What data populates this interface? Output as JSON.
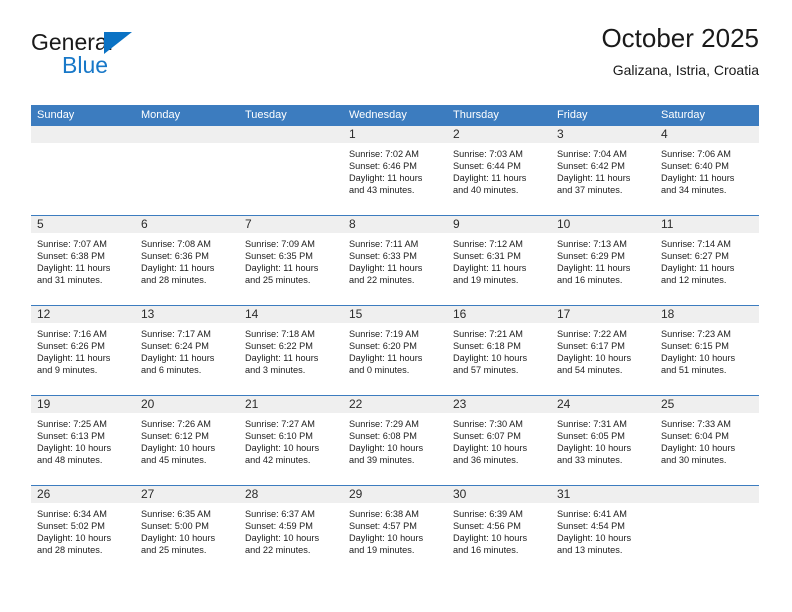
{
  "brand": {
    "name_top": "General",
    "name_bottom": "Blue",
    "triangle_icon": "triangle-icon",
    "accent_color": "#1878c8"
  },
  "header": {
    "title": "October 2025",
    "subtitle": "Galizana, Istria, Croatia"
  },
  "theme": {
    "header_blue": "#3c7cbf",
    "day_band_gray": "#efefef",
    "text_color": "#1d1d1d"
  },
  "calendar": {
    "weekdays": [
      "Sunday",
      "Monday",
      "Tuesday",
      "Wednesday",
      "Thursday",
      "Friday",
      "Saturday"
    ],
    "weeks": [
      [
        {
          "day": "",
          "empty": true,
          "lines": []
        },
        {
          "day": "",
          "empty": true,
          "lines": []
        },
        {
          "day": "",
          "empty": true,
          "lines": []
        },
        {
          "day": "1",
          "empty": false,
          "lines": [
            "Sunrise: 7:02 AM",
            "Sunset: 6:46 PM",
            "Daylight: 11 hours",
            "and 43 minutes."
          ]
        },
        {
          "day": "2",
          "empty": false,
          "lines": [
            "Sunrise: 7:03 AM",
            "Sunset: 6:44 PM",
            "Daylight: 11 hours",
            "and 40 minutes."
          ]
        },
        {
          "day": "3",
          "empty": false,
          "lines": [
            "Sunrise: 7:04 AM",
            "Sunset: 6:42 PM",
            "Daylight: 11 hours",
            "and 37 minutes."
          ]
        },
        {
          "day": "4",
          "empty": false,
          "lines": [
            "Sunrise: 7:06 AM",
            "Sunset: 6:40 PM",
            "Daylight: 11 hours",
            "and 34 minutes."
          ]
        }
      ],
      [
        {
          "day": "5",
          "empty": false,
          "lines": [
            "Sunrise: 7:07 AM",
            "Sunset: 6:38 PM",
            "Daylight: 11 hours",
            "and 31 minutes."
          ]
        },
        {
          "day": "6",
          "empty": false,
          "lines": [
            "Sunrise: 7:08 AM",
            "Sunset: 6:36 PM",
            "Daylight: 11 hours",
            "and 28 minutes."
          ]
        },
        {
          "day": "7",
          "empty": false,
          "lines": [
            "Sunrise: 7:09 AM",
            "Sunset: 6:35 PM",
            "Daylight: 11 hours",
            "and 25 minutes."
          ]
        },
        {
          "day": "8",
          "empty": false,
          "lines": [
            "Sunrise: 7:11 AM",
            "Sunset: 6:33 PM",
            "Daylight: 11 hours",
            "and 22 minutes."
          ]
        },
        {
          "day": "9",
          "empty": false,
          "lines": [
            "Sunrise: 7:12 AM",
            "Sunset: 6:31 PM",
            "Daylight: 11 hours",
            "and 19 minutes."
          ]
        },
        {
          "day": "10",
          "empty": false,
          "lines": [
            "Sunrise: 7:13 AM",
            "Sunset: 6:29 PM",
            "Daylight: 11 hours",
            "and 16 minutes."
          ]
        },
        {
          "day": "11",
          "empty": false,
          "lines": [
            "Sunrise: 7:14 AM",
            "Sunset: 6:27 PM",
            "Daylight: 11 hours",
            "and 12 minutes."
          ]
        }
      ],
      [
        {
          "day": "12",
          "empty": false,
          "lines": [
            "Sunrise: 7:16 AM",
            "Sunset: 6:26 PM",
            "Daylight: 11 hours",
            "and 9 minutes."
          ]
        },
        {
          "day": "13",
          "empty": false,
          "lines": [
            "Sunrise: 7:17 AM",
            "Sunset: 6:24 PM",
            "Daylight: 11 hours",
            "and 6 minutes."
          ]
        },
        {
          "day": "14",
          "empty": false,
          "lines": [
            "Sunrise: 7:18 AM",
            "Sunset: 6:22 PM",
            "Daylight: 11 hours",
            "and 3 minutes."
          ]
        },
        {
          "day": "15",
          "empty": false,
          "lines": [
            "Sunrise: 7:19 AM",
            "Sunset: 6:20 PM",
            "Daylight: 11 hours",
            "and 0 minutes."
          ]
        },
        {
          "day": "16",
          "empty": false,
          "lines": [
            "Sunrise: 7:21 AM",
            "Sunset: 6:18 PM",
            "Daylight: 10 hours",
            "and 57 minutes."
          ]
        },
        {
          "day": "17",
          "empty": false,
          "lines": [
            "Sunrise: 7:22 AM",
            "Sunset: 6:17 PM",
            "Daylight: 10 hours",
            "and 54 minutes."
          ]
        },
        {
          "day": "18",
          "empty": false,
          "lines": [
            "Sunrise: 7:23 AM",
            "Sunset: 6:15 PM",
            "Daylight: 10 hours",
            "and 51 minutes."
          ]
        }
      ],
      [
        {
          "day": "19",
          "empty": false,
          "lines": [
            "Sunrise: 7:25 AM",
            "Sunset: 6:13 PM",
            "Daylight: 10 hours",
            "and 48 minutes."
          ]
        },
        {
          "day": "20",
          "empty": false,
          "lines": [
            "Sunrise: 7:26 AM",
            "Sunset: 6:12 PM",
            "Daylight: 10 hours",
            "and 45 minutes."
          ]
        },
        {
          "day": "21",
          "empty": false,
          "lines": [
            "Sunrise: 7:27 AM",
            "Sunset: 6:10 PM",
            "Daylight: 10 hours",
            "and 42 minutes."
          ]
        },
        {
          "day": "22",
          "empty": false,
          "lines": [
            "Sunrise: 7:29 AM",
            "Sunset: 6:08 PM",
            "Daylight: 10 hours",
            "and 39 minutes."
          ]
        },
        {
          "day": "23",
          "empty": false,
          "lines": [
            "Sunrise: 7:30 AM",
            "Sunset: 6:07 PM",
            "Daylight: 10 hours",
            "and 36 minutes."
          ]
        },
        {
          "day": "24",
          "empty": false,
          "lines": [
            "Sunrise: 7:31 AM",
            "Sunset: 6:05 PM",
            "Daylight: 10 hours",
            "and 33 minutes."
          ]
        },
        {
          "day": "25",
          "empty": false,
          "lines": [
            "Sunrise: 7:33 AM",
            "Sunset: 6:04 PM",
            "Daylight: 10 hours",
            "and 30 minutes."
          ]
        }
      ],
      [
        {
          "day": "26",
          "empty": false,
          "lines": [
            "Sunrise: 6:34 AM",
            "Sunset: 5:02 PM",
            "Daylight: 10 hours",
            "and 28 minutes."
          ]
        },
        {
          "day": "27",
          "empty": false,
          "lines": [
            "Sunrise: 6:35 AM",
            "Sunset: 5:00 PM",
            "Daylight: 10 hours",
            "and 25 minutes."
          ]
        },
        {
          "day": "28",
          "empty": false,
          "lines": [
            "Sunrise: 6:37 AM",
            "Sunset: 4:59 PM",
            "Daylight: 10 hours",
            "and 22 minutes."
          ]
        },
        {
          "day": "29",
          "empty": false,
          "lines": [
            "Sunrise: 6:38 AM",
            "Sunset: 4:57 PM",
            "Daylight: 10 hours",
            "and 19 minutes."
          ]
        },
        {
          "day": "30",
          "empty": false,
          "lines": [
            "Sunrise: 6:39 AM",
            "Sunset: 4:56 PM",
            "Daylight: 10 hours",
            "and 16 minutes."
          ]
        },
        {
          "day": "31",
          "empty": false,
          "lines": [
            "Sunrise: 6:41 AM",
            "Sunset: 4:54 PM",
            "Daylight: 10 hours",
            "and 13 minutes."
          ]
        },
        {
          "day": "",
          "empty": true,
          "lines": []
        }
      ]
    ]
  }
}
